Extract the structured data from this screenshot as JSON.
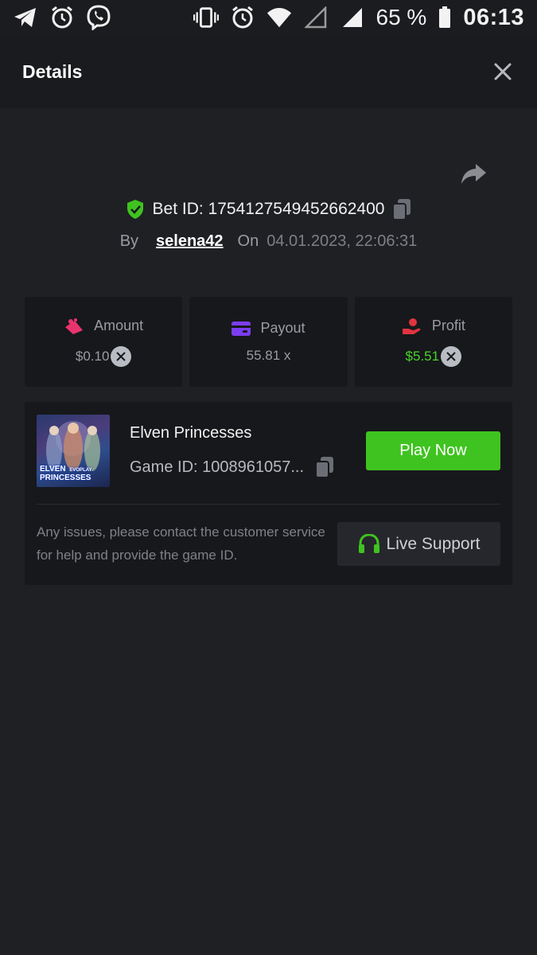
{
  "status_bar": {
    "battery_percent": "65 %",
    "time": "06:13",
    "left_icons": [
      "telegram-icon",
      "alarm-icon",
      "viber-icon"
    ],
    "right_icons": [
      "vibrate-icon",
      "alarm-icon",
      "wifi-icon",
      "signal-empty-icon",
      "signal-icon",
      "battery-icon"
    ]
  },
  "header": {
    "title": "Details",
    "close_icon": "close-icon"
  },
  "bet": {
    "id_text": "Bet ID: 1754127549452662400",
    "by_label": "By",
    "user": "selena42",
    "on_label": "On",
    "date": "04.01.2023, 22:06:31"
  },
  "stats": [
    {
      "label": "Amount",
      "value": "$0.10",
      "icon": "amount-icon",
      "has_coin": true
    },
    {
      "label": "Payout",
      "value": "55.81 x",
      "icon": "wallet-icon",
      "has_coin": false
    },
    {
      "label": "Profit",
      "value": "$5.51",
      "icon": "profit-icon",
      "has_coin": true
    }
  ],
  "game": {
    "name": "Elven Princesses",
    "id_text": "Game ID: 1008961057...",
    "thumb_title_line1": "ELVEN",
    "thumb_title_line2": "PRINCESSES",
    "thumb_brand": "EVOPLAY",
    "play_label": "Play Now",
    "help_text": "Any issues, please contact the customer service for help and provide the game ID.",
    "support_label": "Live Support"
  },
  "colors": {
    "background": "#1f2024",
    "card": "#17181b",
    "accent_green": "#3fc320",
    "profit_green": "#47d52a",
    "amount_pink": "#e8336f",
    "payout_purple": "#7b3df0",
    "profit_red": "#e2343f"
  }
}
